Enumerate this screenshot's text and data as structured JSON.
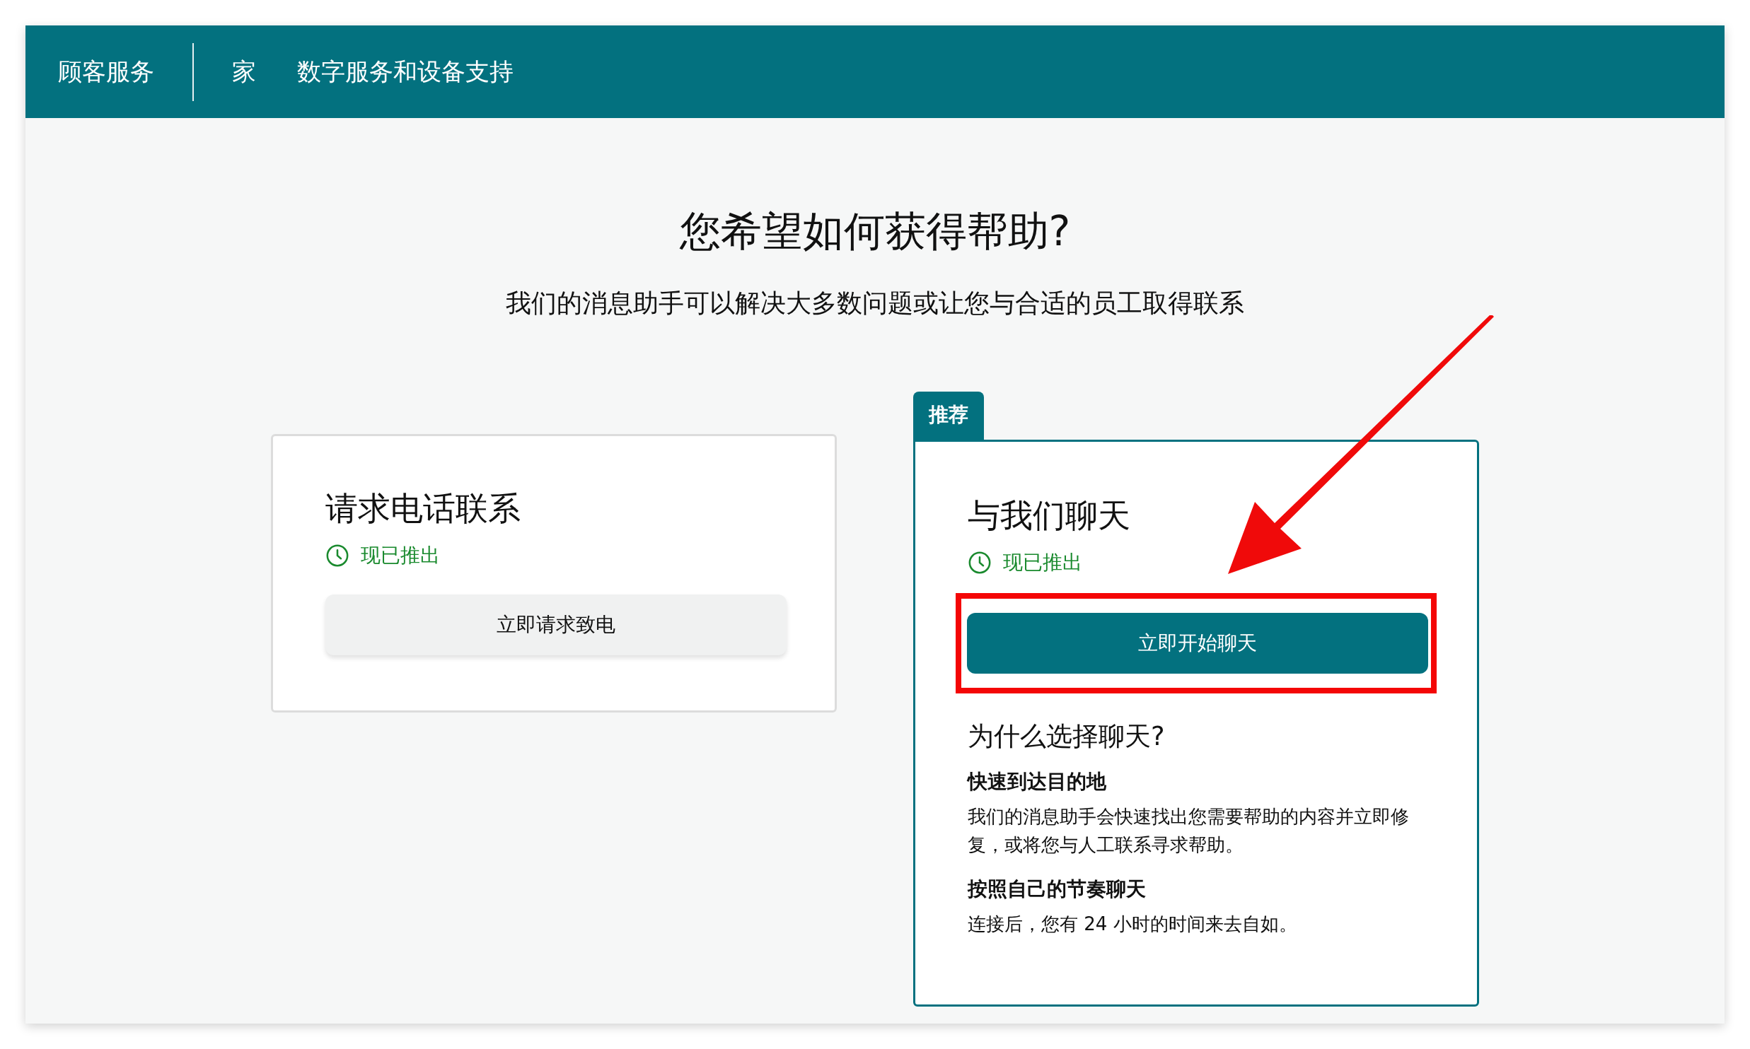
{
  "header": {
    "brand": "顾客服务",
    "nav": [
      "家",
      "数字服务和设备支持"
    ]
  },
  "heading": "您希望如何获得帮助?",
  "subheading": "我们的消息助手可以解决大多数问题或让您与合适的员工取得联系",
  "options": [
    {
      "title": "请求电话联系",
      "status": "现已推出",
      "button": {
        "label": "立即请求致电",
        "kind": "secondary"
      },
      "recommended": false,
      "highlighted": false
    },
    {
      "badge": "推荐",
      "title": "与我们聊天",
      "status": "现已推出",
      "button": {
        "label": "立即开始聊天",
        "kind": "primary"
      },
      "recommended": true,
      "highlighted": true,
      "why": {
        "title": "为什么选择聊天?",
        "reasons": [
          {
            "title": "快速到达目的地",
            "text": "我们的消息助手会快速找出您需要帮助的内容并立即修复，或将您与人工联系寻求帮助。"
          },
          {
            "title": "按照自己的节奏聊天",
            "text": "连接后，您有 24 小时的时间来去自如。"
          }
        ]
      }
    }
  ]
}
